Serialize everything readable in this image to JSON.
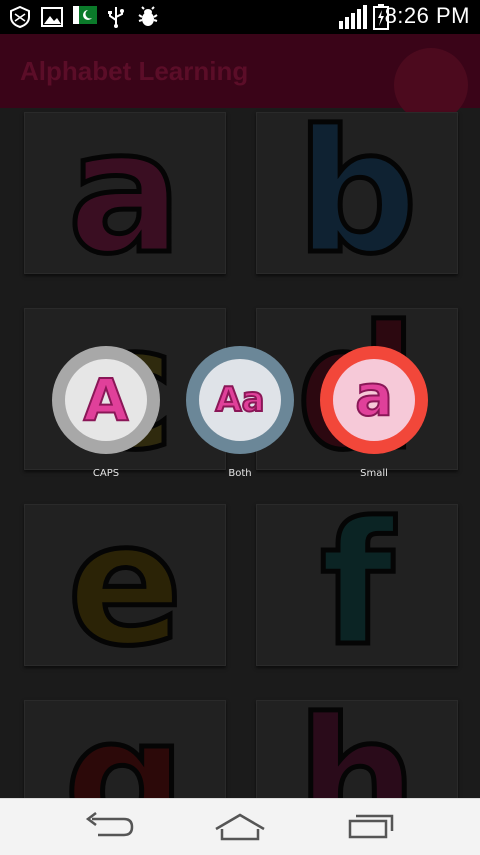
{
  "status_bar": {
    "time": "8:26 PM",
    "icons": [
      "shield-icon",
      "image-icon",
      "pakistan-flag-icon",
      "usb-icon",
      "bug-icon"
    ],
    "right_icons": [
      "signal-icon",
      "battery-charging-icon"
    ]
  },
  "app_bar": {
    "title": "Alphabet Learning"
  },
  "grid": {
    "letters": [
      {
        "char": "a",
        "color": "#3a0e22"
      },
      {
        "char": "b",
        "color": "#0f2232"
      },
      {
        "char": "c",
        "color": "#2f2a0e"
      },
      {
        "char": "d",
        "color": "#2c0810"
      },
      {
        "char": "e",
        "color": "#2b2306"
      },
      {
        "char": "f",
        "color": "#0b2424"
      },
      {
        "char": "g",
        "color": "#2c0909"
      },
      {
        "char": "h",
        "color": "#2a0b1a"
      }
    ]
  },
  "mode_options": [
    {
      "label": "CAPS",
      "glyph": "A",
      "ring_color": "#a8a8a8",
      "inner_color": "#e6e6e6"
    },
    {
      "label": "Both",
      "glyph": "Aa",
      "ring_color": "#6b8798",
      "inner_color": "#dfe3e8"
    },
    {
      "label": "Small",
      "glyph": "a",
      "ring_color": "#f2473a",
      "inner_color": "#f6c9d8"
    }
  ],
  "nav_bar": {
    "buttons": [
      "back-icon",
      "home-icon",
      "recent-apps-icon"
    ]
  }
}
